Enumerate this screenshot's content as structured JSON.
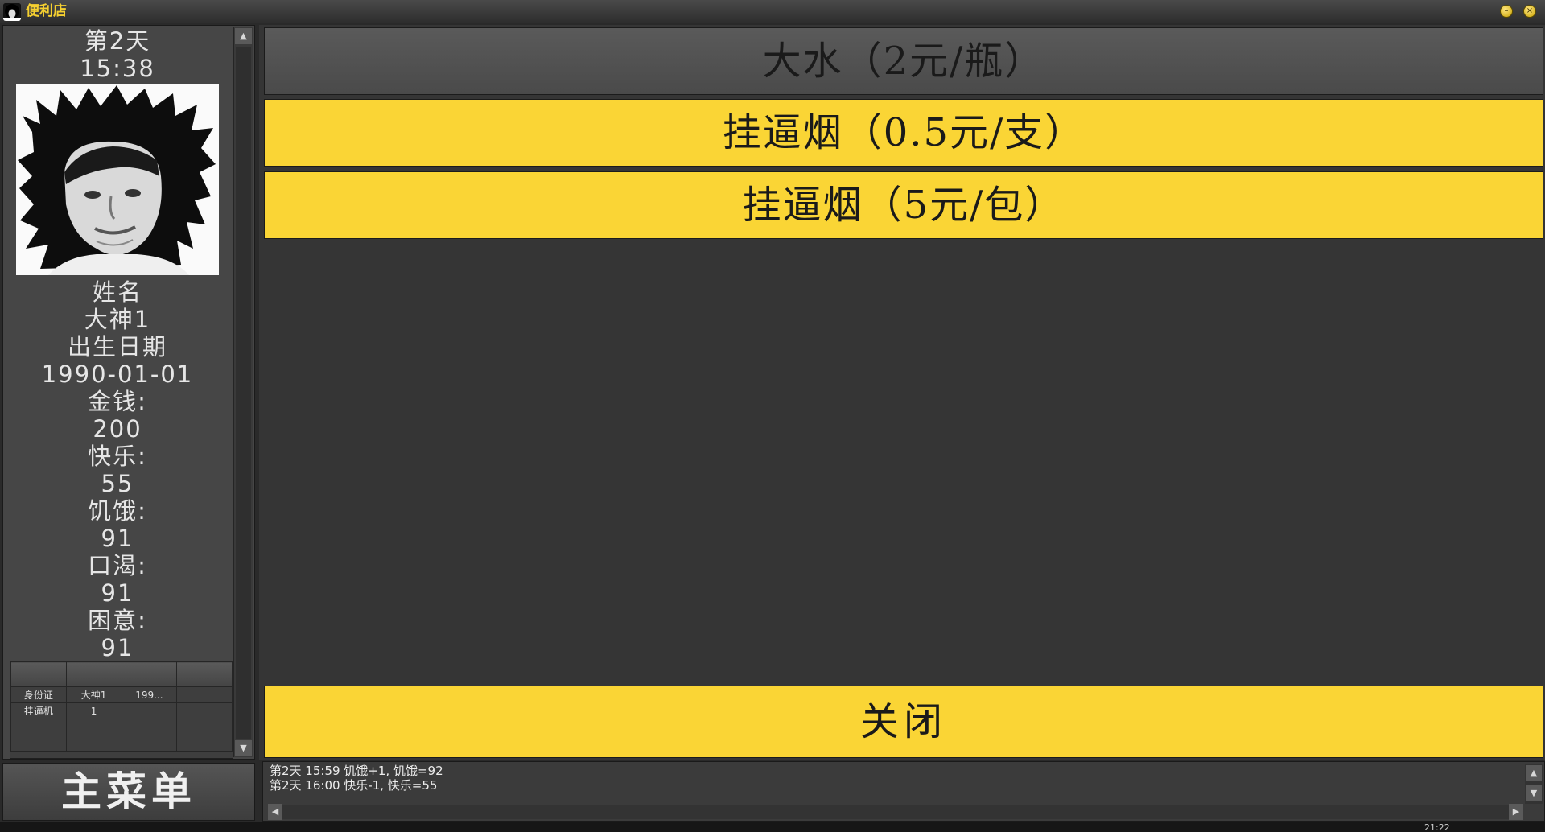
{
  "window": {
    "title": "便利店"
  },
  "left_panel": {
    "day": "第2天",
    "time": "15:38",
    "name_label": "姓名",
    "name_value": "大神1",
    "birth_label": "出生日期",
    "birth_value": "1990-01-01",
    "money_label": "金钱:",
    "money_value": "200",
    "happy_label": "快乐:",
    "happy_value": "55",
    "hunger_label": "饥饿:",
    "hunger_value": "91",
    "thirst_label": "口渴:",
    "thirst_value": "91",
    "sleepy_label": "困意:",
    "sleepy_value": "91",
    "inventory": {
      "rows": [
        [
          "身份证",
          "大神1",
          "199...",
          ""
        ],
        [
          "挂逼机",
          "1",
          "",
          ""
        ],
        [
          "",
          "",
          "",
          ""
        ],
        [
          "",
          "",
          "",
          ""
        ]
      ]
    }
  },
  "main_menu": {
    "label": "主菜单"
  },
  "shop": {
    "items": [
      {
        "label": "大水（2元/瓶）",
        "style": "gray"
      },
      {
        "label": "挂逼烟（0.5元/支）",
        "style": "yellow"
      },
      {
        "label": "挂逼烟（5元/包）",
        "style": "yellow"
      }
    ],
    "close_label": "关闭"
  },
  "log": {
    "lines": [
      "第2天 15:59 饥饿+1, 饥饿=92",
      "第2天 16:00 快乐-1, 快乐=55"
    ]
  },
  "taskbar": {
    "clock_fragment": "21:22"
  },
  "colors": {
    "accent_yellow": "#fad535",
    "title_yellow": "#f5d030",
    "panel_gray": "#464646",
    "background_dark": "#353535"
  }
}
